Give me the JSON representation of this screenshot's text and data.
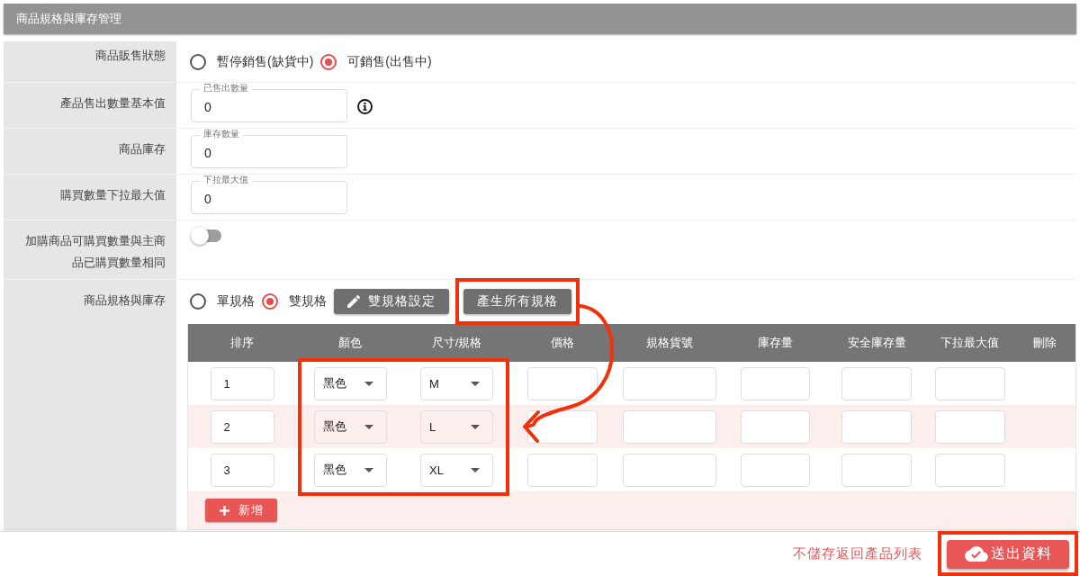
{
  "panel": {
    "title": "商品規格與庫存管理"
  },
  "fields": [
    {
      "kind": "radio",
      "label": "商品販售狀態",
      "options": [
        {
          "label": "暫停銷售(缺貨中)",
          "selected": false
        },
        {
          "label": "可銷售(出售中)",
          "selected": true
        }
      ]
    },
    {
      "kind": "number",
      "label": "產品售出數量基本值",
      "field_label": "已售出數量",
      "value": "0",
      "info": true
    },
    {
      "kind": "number",
      "label": "商品庫存",
      "field_label": "庫存數量",
      "value": "0",
      "info": false
    },
    {
      "kind": "number",
      "label": "購買數量下拉最大值",
      "field_label": "下拉最大值",
      "value": "0",
      "info": false
    },
    {
      "kind": "toggle",
      "label": "加購商品可購買數量與主商品已購買數量相同",
      "on": false
    },
    {
      "kind": "spec",
      "label": "商品規格與庫存",
      "options": [
        {
          "label": "單規格",
          "selected": false
        },
        {
          "label": "雙規格",
          "selected": true
        }
      ],
      "buttons": [
        {
          "kind": "edit",
          "label": "雙規格設定",
          "highlighted": false
        },
        {
          "kind": "plain",
          "label": "產生所有規格",
          "highlighted": true
        }
      ],
      "table": {
        "columns": [
          {
            "label": "排序",
            "kind": "number",
            "highlighted": false
          },
          {
            "label": "顏色",
            "kind": "select",
            "highlighted": true
          },
          {
            "label": "尺寸/規格",
            "kind": "select",
            "highlighted": true
          },
          {
            "label": "價格",
            "kind": "text",
            "highlighted": false
          },
          {
            "label": "規格貨號",
            "kind": "text",
            "highlighted": false
          },
          {
            "label": "庫存量",
            "kind": "text",
            "highlighted": false
          },
          {
            "label": "安全庫存量",
            "kind": "text",
            "highlighted": false
          },
          {
            "label": "下拉最大值",
            "kind": "text",
            "highlighted": false
          },
          {
            "label": "刪除",
            "kind": "none",
            "highlighted": false
          }
        ],
        "rows": [
          {
            "cells": [
              "1",
              "黑色",
              "M"
            ]
          },
          {
            "cells": [
              "2",
              "黑色",
              "L"
            ]
          },
          {
            "cells": [
              "3",
              "黑色",
              "XL"
            ]
          }
        ],
        "add_button": "新增"
      }
    }
  ],
  "footer": {
    "back_link": "不儲存返回產品列表",
    "submit": {
      "label": "送出資料",
      "highlighted": true
    }
  },
  "annotation_arrow": true
}
